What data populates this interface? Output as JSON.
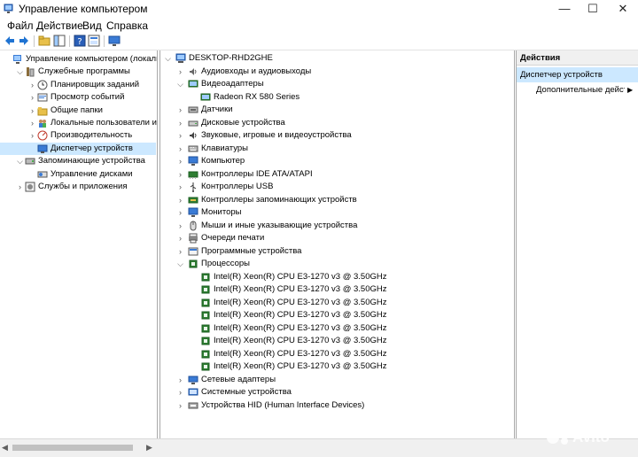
{
  "window": {
    "title": "Управление компьютером",
    "min": "—",
    "max": "☐",
    "close": "✕"
  },
  "menu": [
    {
      "label": "Файл"
    },
    {
      "label": "Действие"
    },
    {
      "label": "Вид"
    },
    {
      "label": "Справка"
    }
  ],
  "left_tree": [
    {
      "label": "Управление компьютером (локальн",
      "icon": "computer-mgmt-icon",
      "level": 0,
      "chevron": "",
      "y": 0
    },
    {
      "label": "Служебные программы",
      "icon": "tools-icon",
      "level": 1,
      "chevron": "v",
      "y": 1
    },
    {
      "label": "Планировщик заданий",
      "icon": "clock-icon",
      "level": 2,
      "chevron": ">",
      "y": 2
    },
    {
      "label": "Просмотр событий",
      "icon": "event-viewer-icon",
      "level": 2,
      "chevron": ">",
      "y": 3
    },
    {
      "label": "Общие папки",
      "icon": "shared-folder-icon",
      "level": 2,
      "chevron": ">",
      "y": 4
    },
    {
      "label": "Локальные пользователи и гр",
      "icon": "users-icon",
      "level": 2,
      "chevron": ">",
      "y": 5
    },
    {
      "label": "Производительность",
      "icon": "performance-icon",
      "level": 2,
      "chevron": ">",
      "y": 6
    },
    {
      "label": "Диспетчер устройств",
      "icon": "device-manager-icon",
      "level": 2,
      "chevron": "",
      "y": 7,
      "selected": true
    },
    {
      "label": "Запоминающие устройства",
      "icon": "storage-icon",
      "level": 1,
      "chevron": "v",
      "y": 8
    },
    {
      "label": "Управление дисками",
      "icon": "disk-mgmt-icon",
      "level": 2,
      "chevron": "",
      "y": 9
    },
    {
      "label": "Службы и приложения",
      "icon": "services-icon",
      "level": 1,
      "chevron": ">",
      "y": 10
    }
  ],
  "device_tree": [
    {
      "label": "DESKTOP-RHD2GHE",
      "icon": "computer-icon",
      "level": 0,
      "chevron": "v"
    },
    {
      "label": "Аудиовходы и аудиовыходы",
      "icon": "audio-icon",
      "level": 1,
      "chevron": ">"
    },
    {
      "label": "Видеоадаптеры",
      "icon": "display-adapter-icon",
      "level": 1,
      "chevron": "v"
    },
    {
      "label": "Radeon RX 580 Series",
      "icon": "display-adapter-icon",
      "level": 2,
      "chevron": ""
    },
    {
      "label": "Датчики",
      "icon": "sensor-icon",
      "level": 1,
      "chevron": ">"
    },
    {
      "label": "Дисковые устройства",
      "icon": "disk-drive-icon",
      "level": 1,
      "chevron": ">"
    },
    {
      "label": "Звуковые, игровые и видеоустройства",
      "icon": "sound-icon",
      "level": 1,
      "chevron": ">"
    },
    {
      "label": "Клавиатуры",
      "icon": "keyboard-icon",
      "level": 1,
      "chevron": ">"
    },
    {
      "label": "Компьютер",
      "icon": "monitor-icon",
      "level": 1,
      "chevron": ">"
    },
    {
      "label": "Контроллеры IDE ATA/ATAPI",
      "icon": "ide-controller-icon",
      "level": 1,
      "chevron": ">"
    },
    {
      "label": "Контроллеры USB",
      "icon": "usb-icon",
      "level": 1,
      "chevron": ">"
    },
    {
      "label": "Контроллеры запоминающих устройств",
      "icon": "storage-controller-icon",
      "level": 1,
      "chevron": ">"
    },
    {
      "label": "Мониторы",
      "icon": "monitor-icon",
      "level": 1,
      "chevron": ">"
    },
    {
      "label": "Мыши и иные указывающие устройства",
      "icon": "mouse-icon",
      "level": 1,
      "chevron": ">"
    },
    {
      "label": "Очереди печати",
      "icon": "printer-icon",
      "level": 1,
      "chevron": ">"
    },
    {
      "label": "Программные устройства",
      "icon": "software-device-icon",
      "level": 1,
      "chevron": ">"
    },
    {
      "label": "Процессоры",
      "icon": "processor-icon",
      "level": 1,
      "chevron": "v"
    },
    {
      "label": "Intel(R) Xeon(R) CPU E3-1270 v3 @ 3.50GHz",
      "icon": "processor-icon",
      "level": 2,
      "chevron": ""
    },
    {
      "label": "Intel(R) Xeon(R) CPU E3-1270 v3 @ 3.50GHz",
      "icon": "processor-icon",
      "level": 2,
      "chevron": ""
    },
    {
      "label": "Intel(R) Xeon(R) CPU E3-1270 v3 @ 3.50GHz",
      "icon": "processor-icon",
      "level": 2,
      "chevron": ""
    },
    {
      "label": "Intel(R) Xeon(R) CPU E3-1270 v3 @ 3.50GHz",
      "icon": "processor-icon",
      "level": 2,
      "chevron": ""
    },
    {
      "label": "Intel(R) Xeon(R) CPU E3-1270 v3 @ 3.50GHz",
      "icon": "processor-icon",
      "level": 2,
      "chevron": ""
    },
    {
      "label": "Intel(R) Xeon(R) CPU E3-1270 v3 @ 3.50GHz",
      "icon": "processor-icon",
      "level": 2,
      "chevron": ""
    },
    {
      "label": "Intel(R) Xeon(R) CPU E3-1270 v3 @ 3.50GHz",
      "icon": "processor-icon",
      "level": 2,
      "chevron": ""
    },
    {
      "label": "Intel(R) Xeon(R) CPU E3-1270 v3 @ 3.50GHz",
      "icon": "processor-icon",
      "level": 2,
      "chevron": ""
    },
    {
      "label": "Сетевые адаптеры",
      "icon": "network-icon",
      "level": 1,
      "chevron": ">"
    },
    {
      "label": "Системные устройства",
      "icon": "system-device-icon",
      "level": 1,
      "chevron": ">"
    },
    {
      "label": "Устройства HID (Human Interface Devices)",
      "icon": "hid-icon",
      "level": 1,
      "chevron": ">"
    }
  ],
  "actions": {
    "header": "Действия",
    "section": "Диспетчер устройств",
    "more": "Дополнительные действия",
    "more_arrow": "▶"
  },
  "colors": {
    "selection": "#cce8ff",
    "border": "#a9a9a9",
    "panel": "#f0f0f0"
  }
}
